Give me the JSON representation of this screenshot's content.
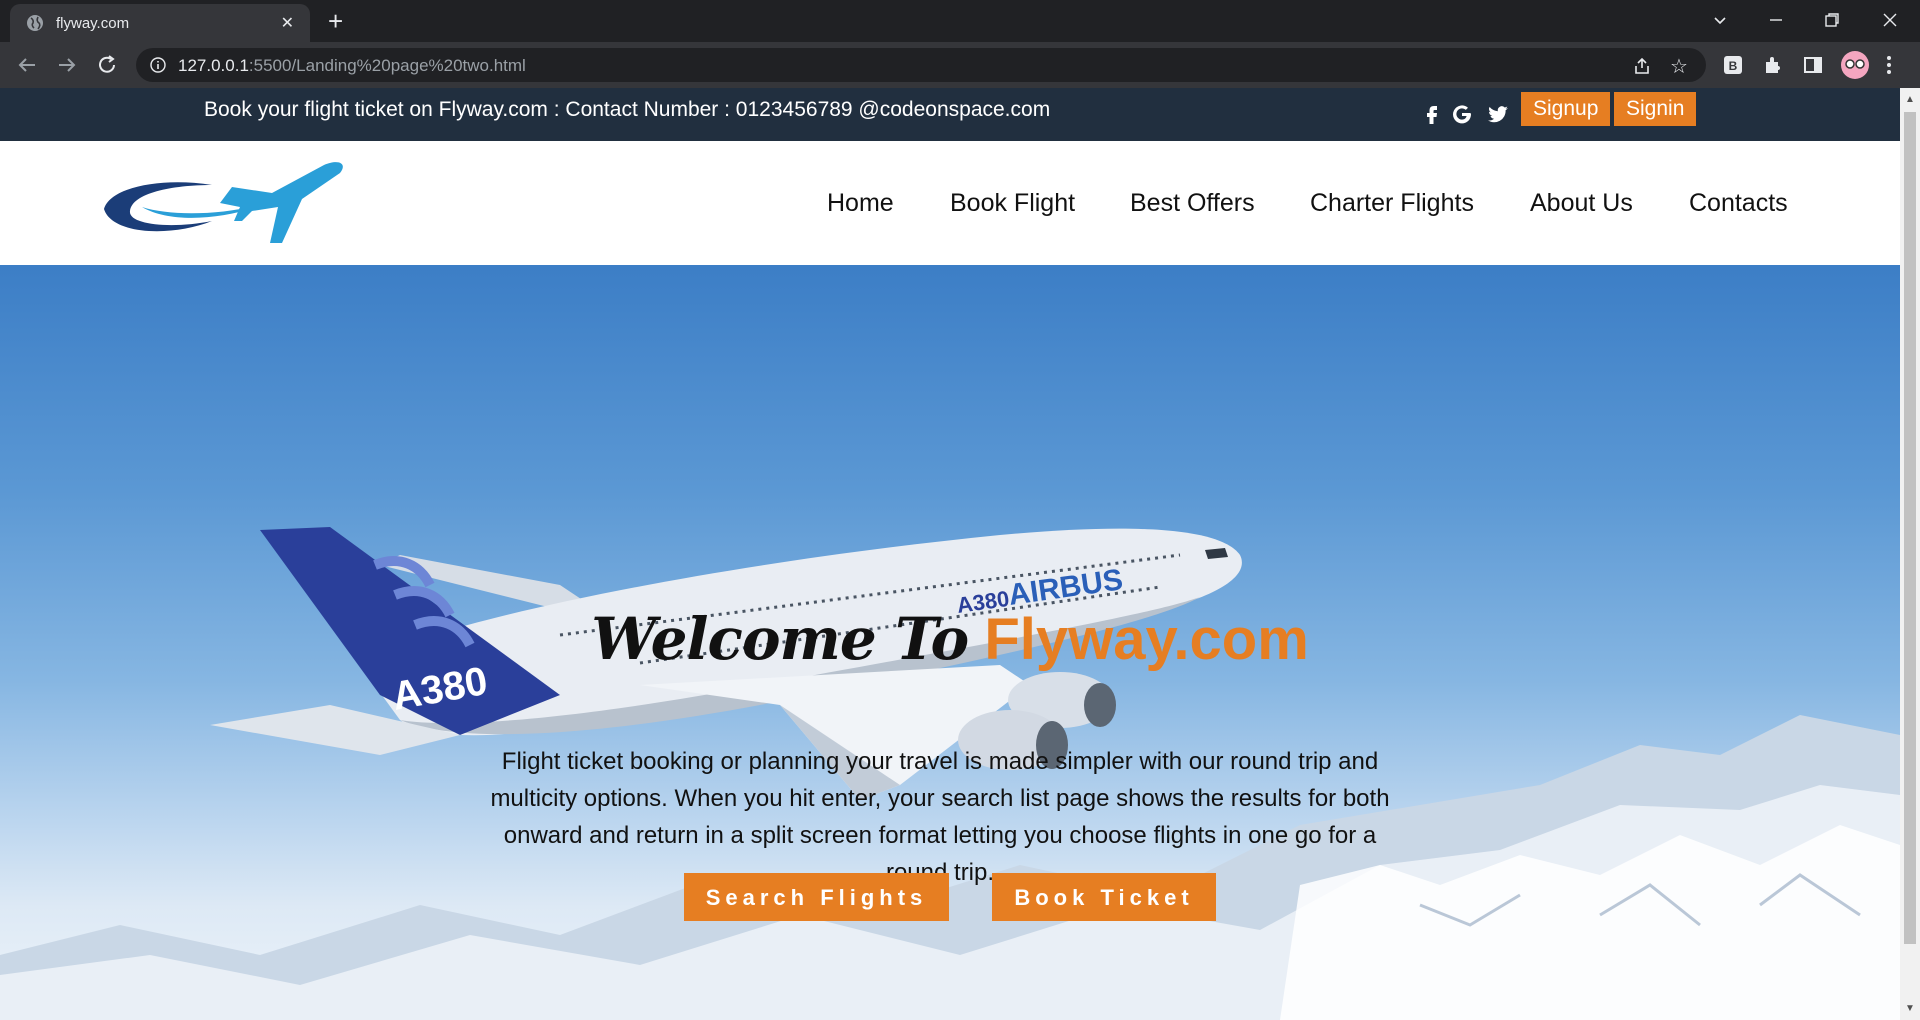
{
  "browser": {
    "tab_title": "flyway.com",
    "tab_close": "✕",
    "new_tab": "+",
    "url_host": "127.0.0.1",
    "url_path": ":5500/Landing%20page%20two.html",
    "ext_b": "B"
  },
  "topbar": {
    "contact": "Book your flight ticket on Flyway.com : Contact Number : 0123456789 @codeonspace.com",
    "signup_label": "Signup",
    "signin_label": "Signin"
  },
  "nav": {
    "items": [
      "Home",
      "Book Flight",
      "Best Offers",
      "Charter Flights",
      "About Us",
      "Contacts"
    ]
  },
  "hero": {
    "welcome_script": "Welcome To",
    "welcome_brand": "Flyway.com",
    "description": "Flight ticket booking or planning your travel is made simpler with our round trip and multicity options. When you hit enter, your search list page shows the results for both onward and return in a split screen format letting you choose flights in one go for a round trip.",
    "search_label": "Search Flights",
    "book_label": "Book Ticket",
    "plane_tail": "A380",
    "plane_body_model": "A380",
    "plane_brand": "AIRBUS"
  },
  "colors": {
    "accent": "#e67e22",
    "topbar_bg": "#212f3f",
    "chrome_dark": "#202124"
  }
}
